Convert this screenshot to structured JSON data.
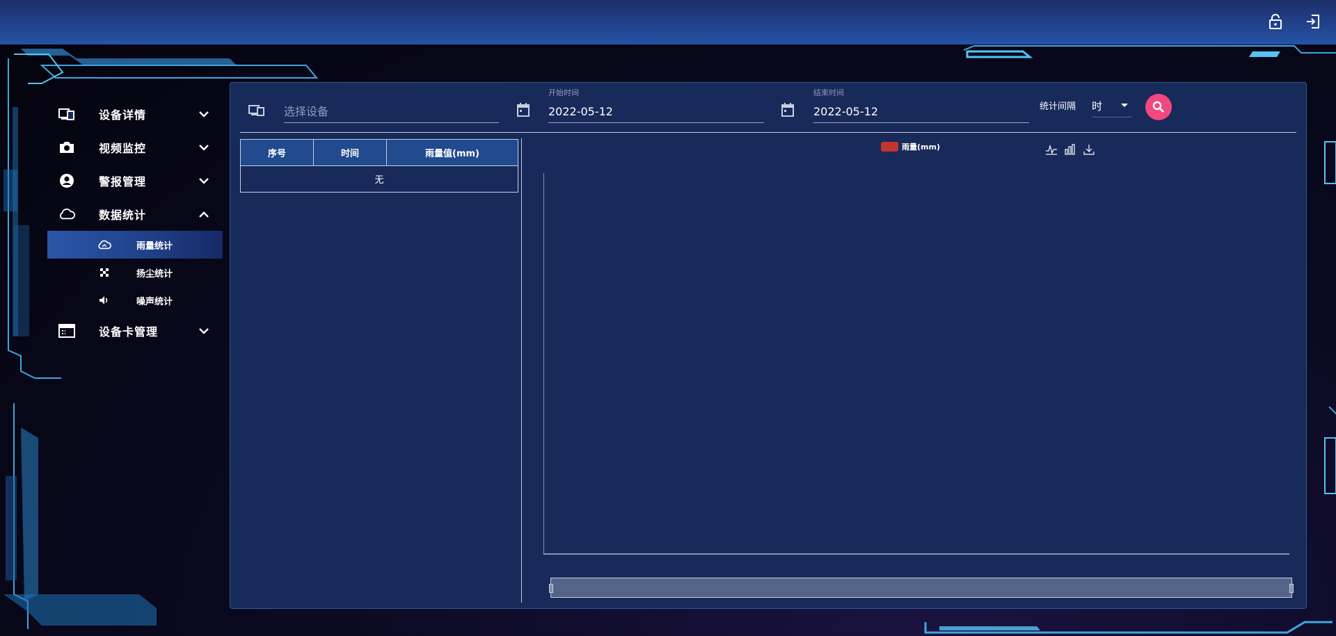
{
  "topbar": {
    "lock_icon": "unlock-icon",
    "logout_icon": "logout-icon"
  },
  "sidebar": {
    "items": [
      {
        "label": "设备详情",
        "icon": "devices-icon",
        "expanded": false
      },
      {
        "label": "视频监控",
        "icon": "camera-icon",
        "expanded": false
      },
      {
        "label": "警报管理",
        "icon": "account-circle-icon",
        "expanded": false
      },
      {
        "label": "数据统计",
        "icon": "cloud-icon",
        "expanded": true,
        "children": [
          {
            "label": "雨量统计",
            "icon": "cloud-outline-icon",
            "active": true
          },
          {
            "label": "扬尘统计",
            "icon": "dust-icon",
            "active": false
          },
          {
            "label": "噪声统计",
            "icon": "volume-icon",
            "active": false
          }
        ]
      },
      {
        "label": "设备卡管理",
        "icon": "card-icon",
        "expanded": false
      }
    ]
  },
  "filters": {
    "device_placeholder": "选择设备",
    "start_caption": "开始时间",
    "start_date": "2022-05-12",
    "end_caption": "结束时间",
    "end_date": "2022-05-12",
    "interval_label": "统计间隔",
    "interval_value": "时"
  },
  "table": {
    "headers": [
      "序号",
      "时间",
      "雨量值(mm)"
    ],
    "empty_text": "无"
  },
  "chart_data": {
    "type": "bar",
    "series": [
      {
        "name": "雨量(mm)",
        "values": []
      }
    ],
    "categories": [],
    "legend_position": "top-center",
    "colors": {
      "series": "#c23531"
    }
  },
  "colors": {
    "accent": "#f0487f",
    "panel": "#182a5a",
    "header": "#214a8f"
  }
}
